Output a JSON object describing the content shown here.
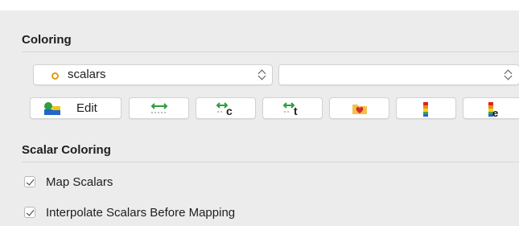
{
  "coloring": {
    "title": "Coloring",
    "array_combo": {
      "selected": "scalars",
      "icon": "point-data-icon"
    },
    "component_combo": {
      "selected": ""
    },
    "buttons": [
      {
        "name": "edit-button",
        "label": "Edit",
        "icon": "color-map-editor-icon"
      },
      {
        "name": "rescale-to-data-range-button",
        "label": "",
        "icon": "rescale-range-icon"
      },
      {
        "name": "rescale-custom-range-button",
        "label": "",
        "icon": "rescale-custom-icon"
      },
      {
        "name": "rescale-temporal-range-button",
        "label": "",
        "icon": "rescale-temporal-icon"
      },
      {
        "name": "favorites-button",
        "label": "",
        "icon": "favorite-folder-icon"
      },
      {
        "name": "color-legend-button",
        "label": "",
        "icon": "color-bar-icon"
      },
      {
        "name": "edit-color-legend-button",
        "label": "",
        "icon": "edit-color-bar-icon"
      }
    ]
  },
  "scalar_coloring": {
    "title": "Scalar Coloring",
    "options": [
      {
        "label": "Map Scalars",
        "checked": true
      },
      {
        "label": "Interpolate Scalars Before Mapping",
        "checked": true
      }
    ]
  },
  "colors": {
    "accent_orange": "#e39a1a",
    "background": "#ececec"
  }
}
